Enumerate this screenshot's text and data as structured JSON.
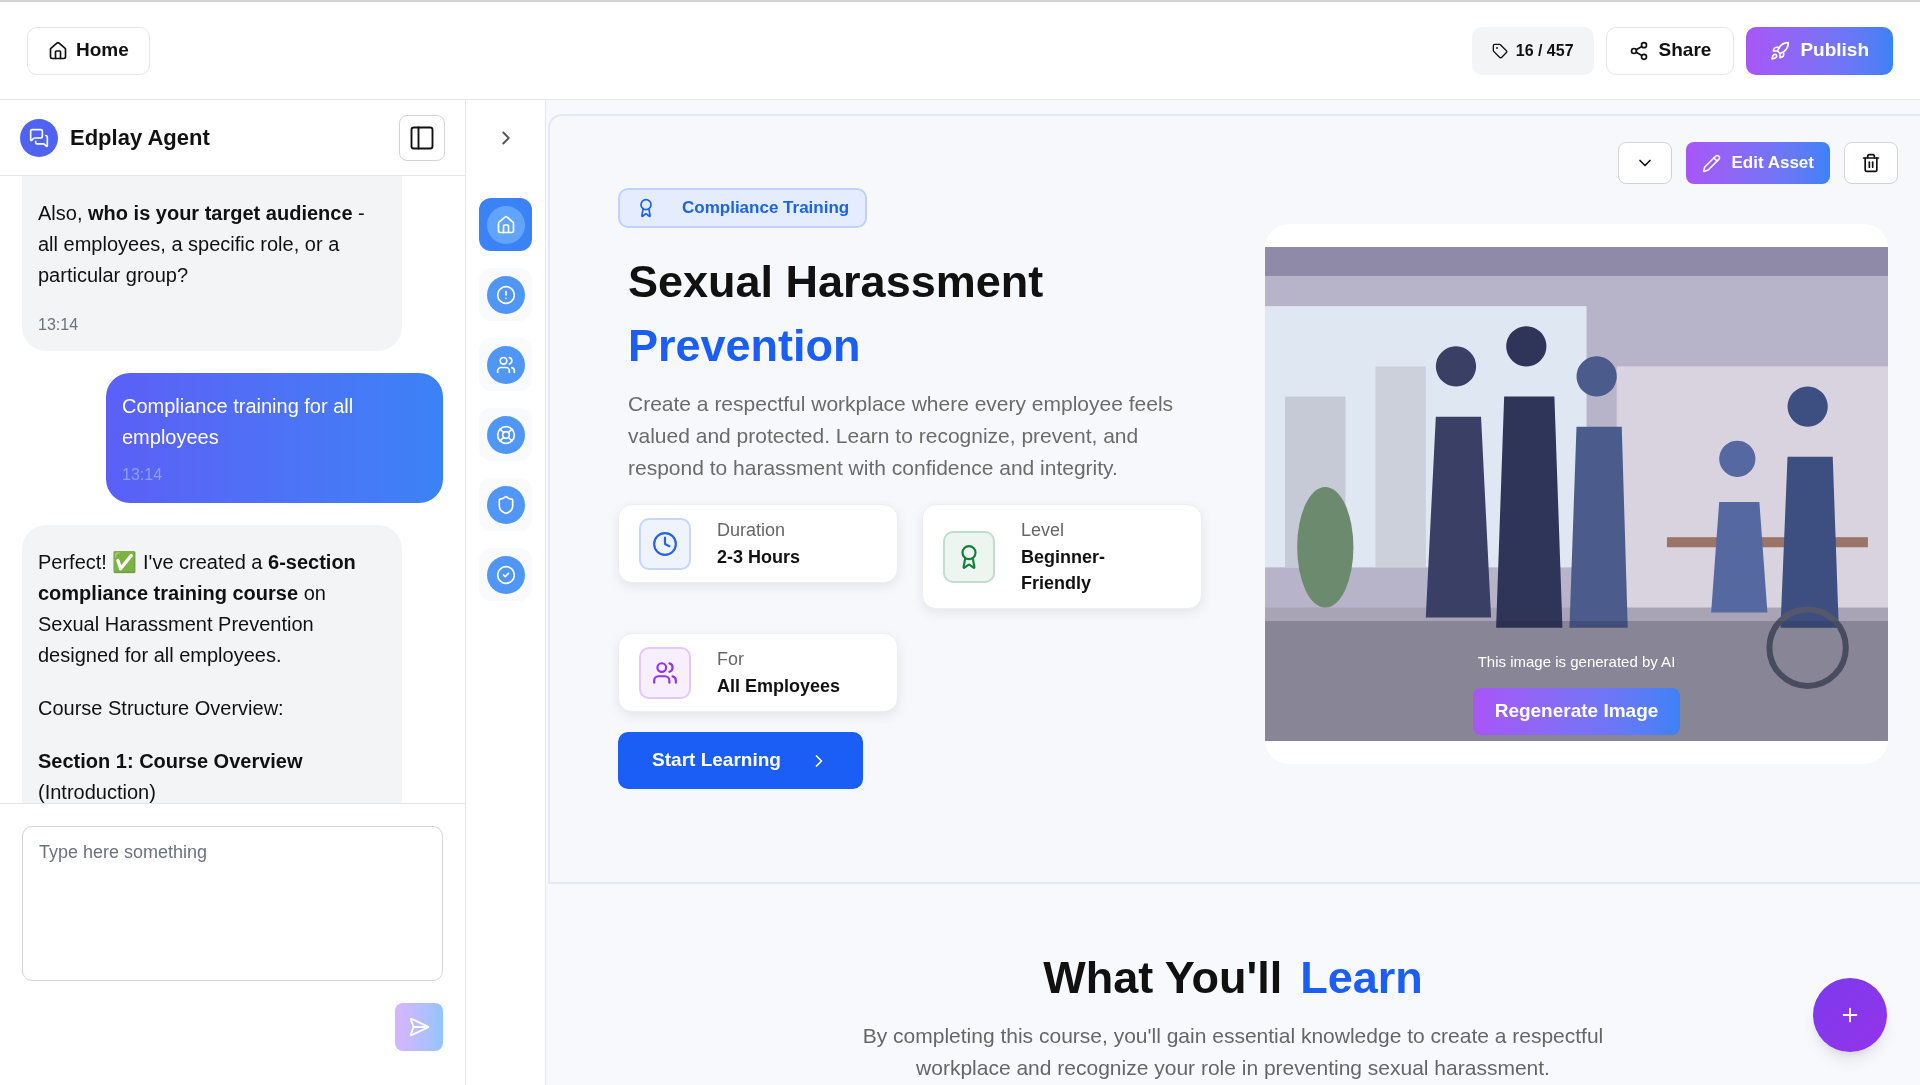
{
  "topbar": {
    "home": "Home",
    "counter": "16 / 457",
    "share": "Share",
    "publish": "Publish"
  },
  "agent": {
    "title": "Edplay Agent",
    "messages": [
      {
        "kind": "agent",
        "paragraphs": [
          "Also, **who is your target audience** - all employees, a specific role, or a particular group?"
        ],
        "time": "13:14"
      },
      {
        "kind": "user",
        "paragraphs": [
          "Compliance training for all employees"
        ],
        "time": "13:14"
      },
      {
        "kind": "agent",
        "paragraphs": [
          "Perfect! ✅ I've created a **6-section compliance training course** on Sexual Harassment Prevention designed for all employees.",
          "Course Structure Overview:",
          "**Section 1: Course Overview**\n(Introduction)"
        ]
      }
    ],
    "input": {
      "placeholder": "Type here something"
    }
  },
  "rail": [
    {
      "selected": true
    },
    {
      "selected": false
    },
    {
      "selected": false
    },
    {
      "selected": false
    },
    {
      "selected": false
    },
    {
      "selected": false
    }
  ],
  "hero": {
    "edit": "Edit Asset",
    "badge": "Compliance Training",
    "title": "Sexual Harassment",
    "title_accent": "Prevention",
    "description": "Create a respectful workplace where every employee feels valued and protected. Learn to recognize, prevent, and respond to harassment with confidence and integrity.",
    "facts": [
      {
        "kind": "clock",
        "label": "Duration",
        "value": "2-3 Hours",
        "color": "#2563eb"
      },
      {
        "kind": "award",
        "label": "Level",
        "value": "Beginner-\nFriendly",
        "color": "#15803d"
      },
      {
        "kind": "people",
        "label": "For",
        "value": "All Employees",
        "color": "#9333ea"
      }
    ],
    "start": "Start Learning",
    "image": {
      "kind": "picture",
      "caption": "This image is generated by AI",
      "regenerate": "Regenerate Image"
    }
  },
  "learn": {
    "title": "What You'll",
    "title_accent": "Learn",
    "description": "By completing this course, you'll gain essential knowledge to create a respectful workplace and recognize your role in preventing sexual harassment."
  }
}
